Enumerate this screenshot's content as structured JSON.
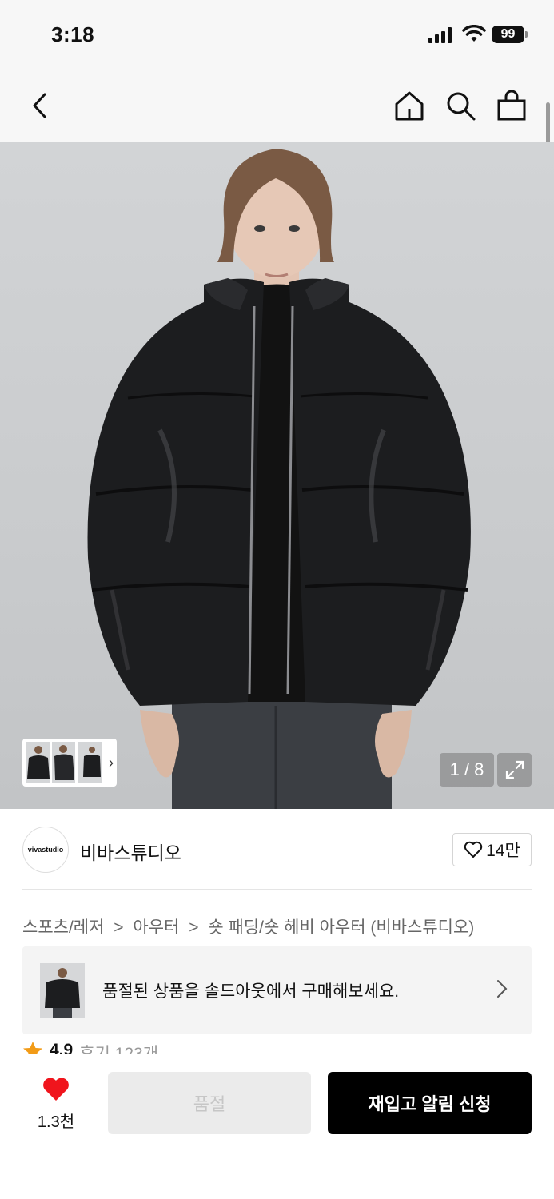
{
  "status_bar": {
    "time": "3:18",
    "battery": "99"
  },
  "nav": {
    "icons": [
      "back-icon",
      "home-icon",
      "search-icon",
      "shopping-bag-icon"
    ]
  },
  "gallery": {
    "page_counter": "1 / 8",
    "thumbnails": 3
  },
  "brand": {
    "logo_text": "vivastudio",
    "name": "비바스튜디오",
    "like_count": "14만"
  },
  "breadcrumb": {
    "items": [
      "스포츠/레저",
      "아우터",
      "숏 패딩/숏 헤비 아우터 (비바스튜디오)"
    ],
    "separator": ">"
  },
  "soldout_banner": {
    "text": "품절된 상품을 솔드아웃에서 구매해보세요."
  },
  "review": {
    "rating": "4.9",
    "summary": "후기 123개"
  },
  "bottom_bar": {
    "heart_count": "1.3천",
    "soldout_label": "품절",
    "restock_label": "재입고 알림 신청"
  },
  "colors": {
    "primary_button": "#000000",
    "heart": "#f0151d",
    "disabled_button": "#ebebeb"
  }
}
